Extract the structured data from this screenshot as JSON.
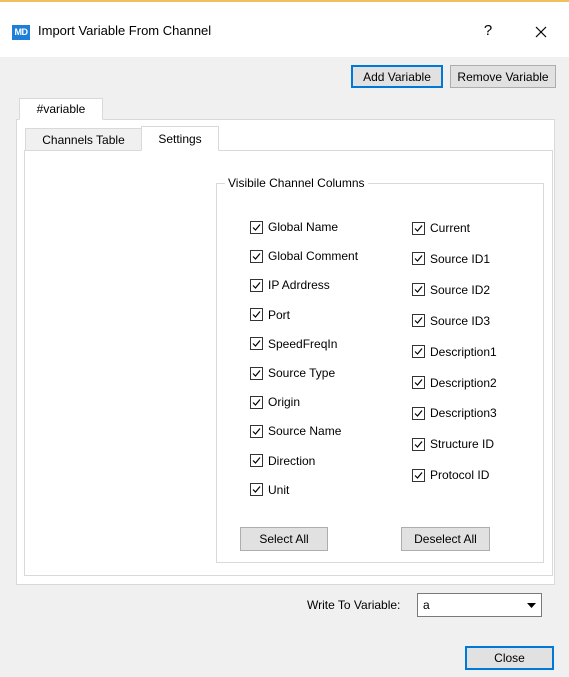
{
  "window": {
    "app_icon_text": "MD",
    "title": "Import Variable From Channel",
    "help_label": "?"
  },
  "toolbar": {
    "add_variable_label": "Add Variable",
    "remove_variable_label": "Remove Variable"
  },
  "outer_tab": {
    "label": "#variable"
  },
  "inner_tabs": [
    {
      "label": "Channels Table",
      "active": false
    },
    {
      "label": "Settings",
      "active": true
    }
  ],
  "settings": {
    "group_title": "Visibile Channel Columns",
    "left_columns": [
      {
        "label": "Global Name",
        "checked": true
      },
      {
        "label": "Global Comment",
        "checked": true
      },
      {
        "label": "IP Adrdress",
        "checked": true
      },
      {
        "label": "Port",
        "checked": true
      },
      {
        "label": "SpeedFreqIn",
        "checked": true
      },
      {
        "label": "Source Type",
        "checked": true
      },
      {
        "label": "Origin",
        "checked": true
      },
      {
        "label": "Source Name",
        "checked": true
      },
      {
        "label": "Direction",
        "checked": true
      },
      {
        "label": "Unit",
        "checked": true
      }
    ],
    "right_columns": [
      {
        "label": "Current",
        "checked": true
      },
      {
        "label": "Source ID1",
        "checked": true
      },
      {
        "label": "Source ID2",
        "checked": true
      },
      {
        "label": "Source ID3",
        "checked": true
      },
      {
        "label": "Description1",
        "checked": true
      },
      {
        "label": "Description2",
        "checked": true
      },
      {
        "label": "Description3",
        "checked": true
      },
      {
        "label": "Structure ID",
        "checked": true
      },
      {
        "label": "Protocol ID",
        "checked": true
      }
    ],
    "select_all_label": "Select All",
    "deselect_all_label": "Deselect All"
  },
  "footer": {
    "write_to_label": "Write To Variable:",
    "write_to_value": "a",
    "close_label": "Close"
  },
  "colors": {
    "accent": "#0078d7",
    "title_top_line": "#f0c060",
    "dialog_bg": "#f0f0f0"
  }
}
